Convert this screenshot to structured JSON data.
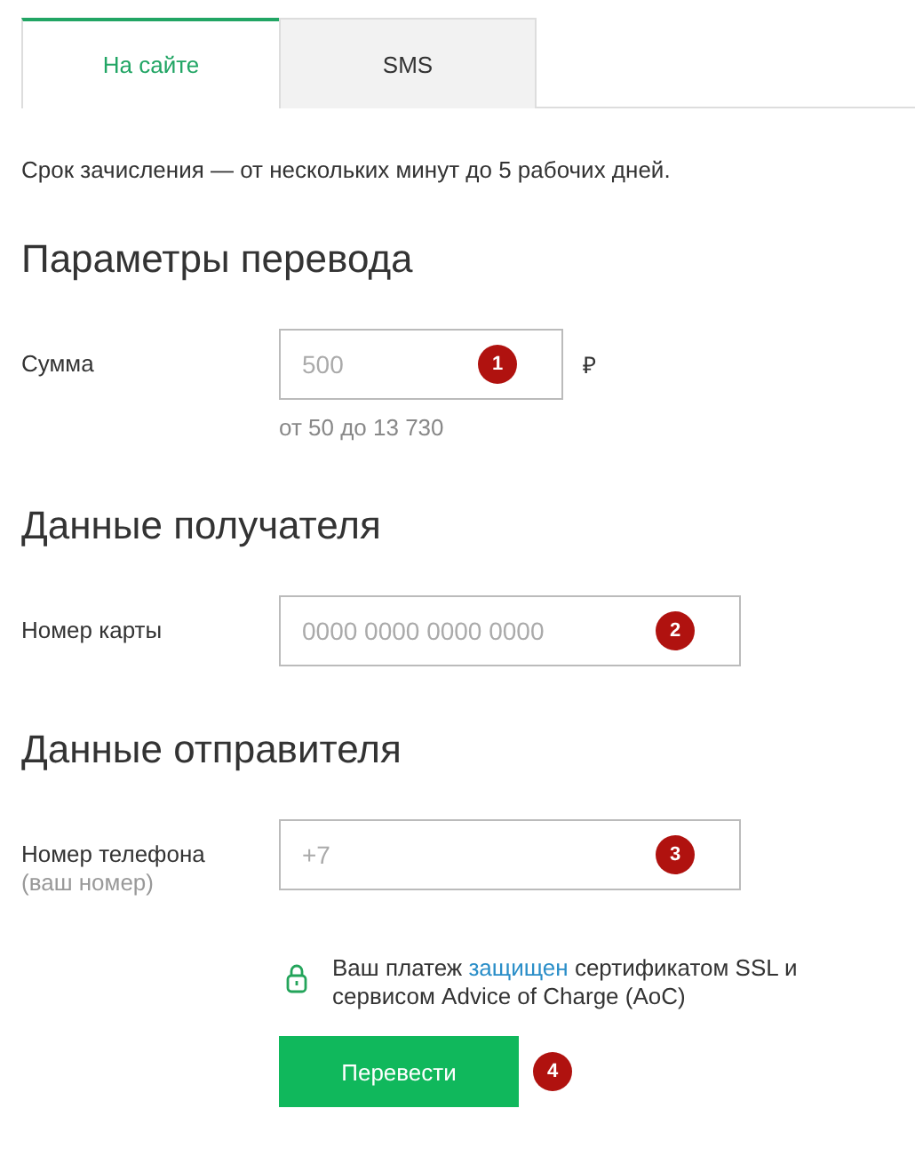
{
  "tabs": [
    {
      "label": "На сайте",
      "selected": true
    },
    {
      "label": "SMS",
      "selected": false
    }
  ],
  "notice": "Срок зачисления — от нескольких минут до 5 рабочих дней.",
  "sections": [
    {
      "title": "Параметры перевода",
      "fields": [
        {
          "kind": "short",
          "label": "Сумма",
          "placeholder": "500",
          "marker": "1",
          "suffix": "₽",
          "hint": "от 50 до 13 730"
        }
      ]
    },
    {
      "title": "Данные получателя",
      "fields": [
        {
          "kind": "wide",
          "label": "Номер карты",
          "placeholder": "0000 0000 0000 0000",
          "marker": "2"
        }
      ]
    },
    {
      "title": "Данные отправителя",
      "fields": [
        {
          "kind": "wide",
          "label": "Номер телефона",
          "sublabel": "(ваш номер)",
          "placeholder": "+7",
          "marker": "3"
        }
      ]
    }
  ],
  "security": {
    "before": "Ваш платеж ",
    "link": "защищен",
    "after": " сертификатом SSL и сервисом Advice of Charge (AoC)"
  },
  "submit": {
    "label": "Перевести",
    "marker": "4"
  }
}
